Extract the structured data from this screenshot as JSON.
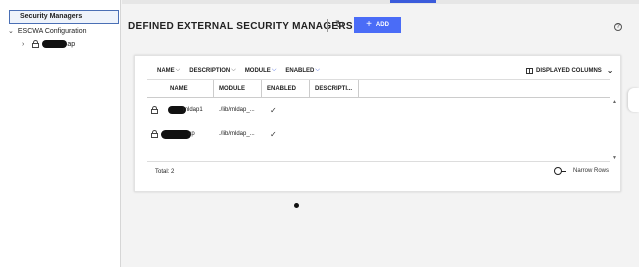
{
  "sidebar": {
    "selected_label": "Security Managers",
    "tree": [
      {
        "label": "ESCWA Configuration",
        "expanded": true
      },
      {
        "label_suffix": "ap",
        "expanded": false
      }
    ]
  },
  "header": {
    "title": "DEFINED EXTERNAL SECURITY MANAGERS",
    "add_label": "ADD",
    "add_color": "#4a6cf7"
  },
  "filters": [
    {
      "label": "NAME"
    },
    {
      "label": "DESCRIPTION"
    },
    {
      "label": "MODULE"
    },
    {
      "label": "ENABLED"
    }
  ],
  "displayed_columns_label": "DISPLAYED COLUMNS",
  "table": {
    "columns": [
      "NAME",
      "MODULE",
      "ENABLED",
      "DESCRIPTI..."
    ],
    "rows": [
      {
        "name_suffix": "mldap1",
        "module": "./lib/mldap_...",
        "enabled": "✓",
        "description": ""
      },
      {
        "name_suffix": "ap",
        "module": "./lib/mldap_...",
        "enabled": "✓",
        "description": ""
      }
    ]
  },
  "footer": {
    "total": "Total: 2",
    "narrow_rows_label": "Narrow Rows"
  }
}
